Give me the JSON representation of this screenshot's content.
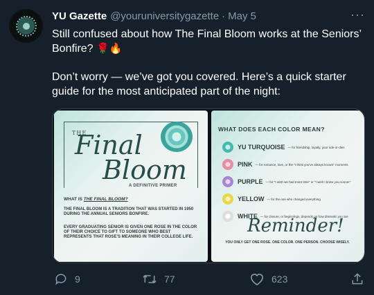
{
  "tweet": {
    "name": "YU Gazette",
    "handle": "@youruniversitygazette",
    "separator": "·",
    "date": "May 5",
    "more": "···",
    "line1": "Still confused about how The Final Bloom works at the Seniors’ Bonfire? ",
    "emoji1": "🌹🔥",
    "line2": "Don’t worry — we’ve got you covered. Here’s a quick starter guide for the most anticipated part of the night:"
  },
  "media": {
    "left": {
      "the": "THE",
      "title1": "Final",
      "title2": "Bloom",
      "primer": "A DEFINITIVE PRIMER",
      "question_prefix": "WHAT IS ",
      "question_em": "THE FINAL BLOOM?",
      "p1": "THE FINAL BLOOM IS A TRADITION THAT WAS STARTED IN 1950 DURING THE ANNUAL SENIORS BONFIRE.",
      "p2": "EVERY GRADUATING SENIOR IS GIVEN ONE ROSE IN THE COLOR OF THEIR CHOICE TO GIFT TO SOMEONE WHO BEST REPRESENTS THAT ROSE'S MEANING IN THEIR COLLEGE LIFE."
    },
    "right": {
      "heading": "WHAT DOES EACH COLOR MEAN?",
      "colors": [
        {
          "name": "YU TURQUOISE",
          "desc": "— for friendship, loyalty, your ride-or-dies",
          "color": "#46b8ad"
        },
        {
          "name": "PINK",
          "desc": "— for romance, love, or the \"I think you've always known\" moments",
          "color": "#e58da3"
        },
        {
          "name": "PURPLE",
          "desc": "— for \"I wish we had more time\" or \"I wish I knew you sooner\"",
          "color": "#a884d2"
        },
        {
          "name": "YELLOW",
          "desc": "— for the one who changed everything",
          "color": "#e8d64b"
        },
        {
          "name": "WHITE",
          "desc": "— for closure, or beginnings, depends on how dramatic you are",
          "color": "#f1f1ef"
        }
      ],
      "reminder": "Reminder!",
      "note": "YOU ONLY GET ONE ROSE. ONE COLOR. ONE PERSON. CHOOSE WISELY."
    }
  },
  "actions": {
    "replies": "9",
    "retweets": "77",
    "likes": "623"
  },
  "colors": {
    "background": "#15202b",
    "muted": "#8b98a5",
    "accent": "#284d48"
  }
}
